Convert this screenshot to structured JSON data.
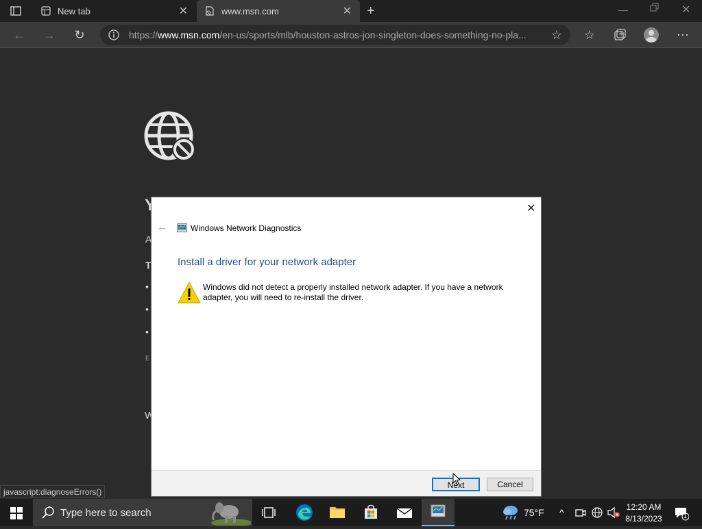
{
  "browser": {
    "tabs": [
      {
        "label": "New tab"
      },
      {
        "label": "www.msn.com"
      }
    ],
    "address": {
      "prefix": "https://",
      "domain": "www.msn.com",
      "path": "/en-us/sports/mlb/houston-astros-jon-singleton-does-something-no-pla..."
    },
    "status_text": "javascript:diagnoseErrors()"
  },
  "page": {
    "fragments": [
      "Y",
      "A",
      "T",
      "•",
      "•",
      "•",
      "E",
      "W"
    ]
  },
  "dialog": {
    "window_title": "Windows Network Diagnostics",
    "heading": "Install a driver for your network adapter",
    "message": "Windows did not detect a properly installed network adapter. If you have a network adapter, you will need to re-install the driver.",
    "next_label": "Next",
    "cancel_label": "Cancel"
  },
  "taskbar": {
    "search_placeholder": "Type here to search",
    "weather": "75°F",
    "time": "12:20 AM",
    "date": "8/13/2023",
    "notification_count": "1"
  },
  "colors": {
    "heading_blue": "#1e4e8c",
    "warning_yellow": "#f6d000",
    "edge_accent": "#0078d4"
  }
}
